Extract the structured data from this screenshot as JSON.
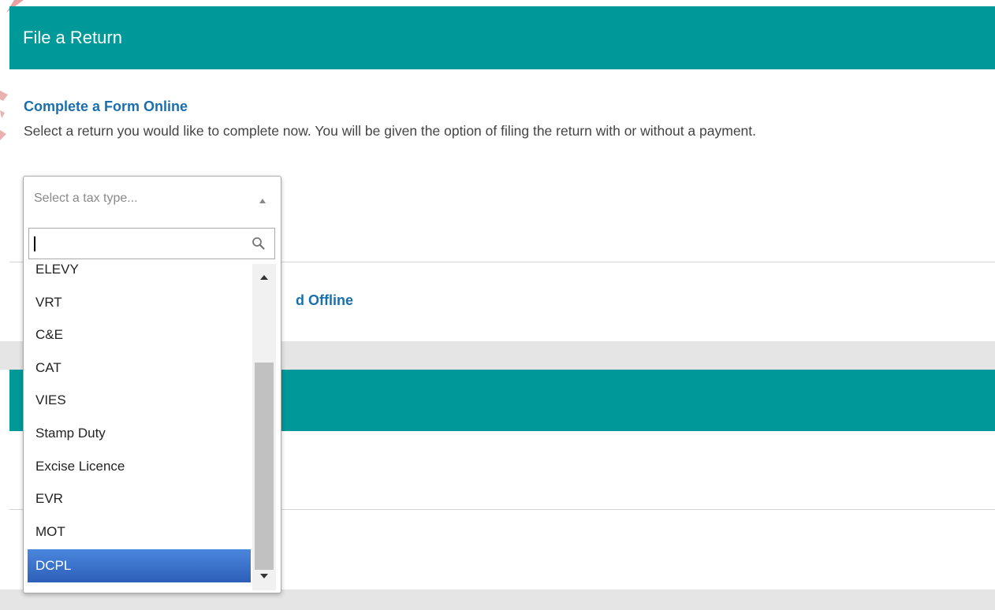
{
  "file_return": {
    "header_title": "File a Return",
    "online_section": {
      "title": "Complete a Form Online",
      "description": "Select a return you would like to complete now. You will be given the option of filing the return with or without a payment."
    },
    "offline_section": {
      "title_visible_fragment": "d Offline"
    }
  },
  "tax_type_select": {
    "placeholder": "Select a tax type...",
    "search_value": "",
    "options": [
      "ELEVY",
      "VRT",
      "C&E",
      "CAT",
      "VIES",
      "Stamp Duty",
      "Excise Licence",
      "EVR",
      "MOT",
      "DCPL"
    ],
    "highlighted_option": "DCPL"
  },
  "colors": {
    "header_teal": "#009999",
    "link_blue": "#1a6fae",
    "highlight_blue": "#3e78d4"
  },
  "icons": [
    "search-icon",
    "chevron-up-icon",
    "scroll-up-arrow-icon",
    "scroll-down-arrow-icon"
  ]
}
